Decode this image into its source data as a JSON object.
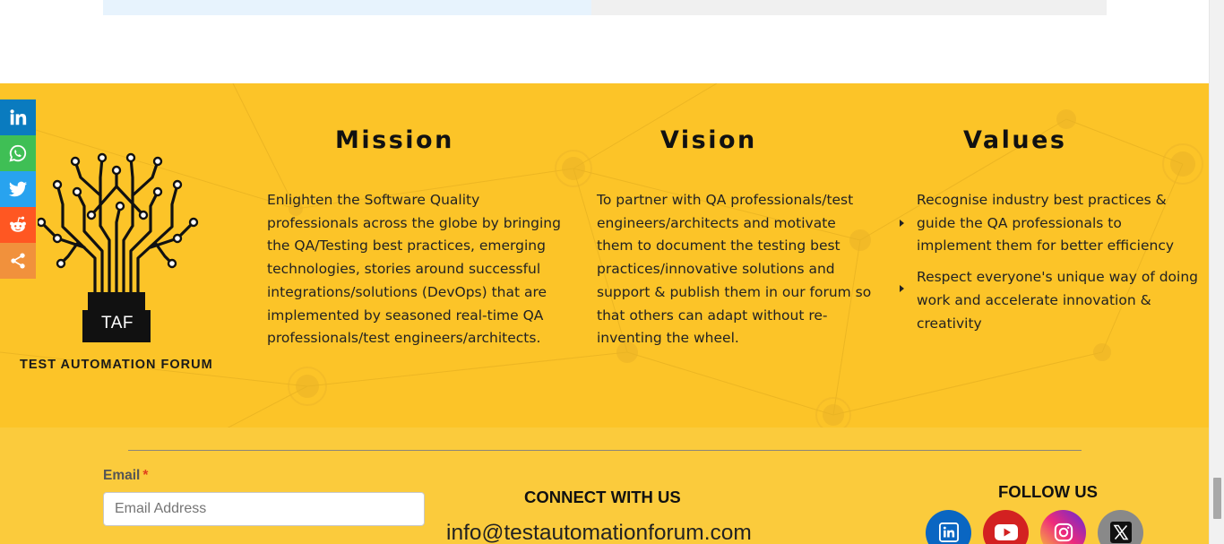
{
  "share_bar": {
    "buttons": [
      {
        "icon": "linkedin-icon",
        "color": "#0a7bbf"
      },
      {
        "icon": "whatsapp-icon",
        "color": "#3fbf55"
      },
      {
        "icon": "twitter-icon",
        "color": "#28a3ef"
      },
      {
        "icon": "reddit-icon",
        "color": "#ff5722"
      },
      {
        "icon": "share-icon",
        "color": "#f1913c"
      }
    ]
  },
  "logo": {
    "badge_text": "TAF",
    "caption": "TEST AUTOMATION FORUM"
  },
  "mission": {
    "title": "Mission",
    "text": "Enlighten the Software Quality professionals across the globe by bringing the QA/Testing best practices, emerging technologies, stories around successful integrations/solutions (DevOps) that are implemented by seasoned real-time QA professionals/test engineers/architects."
  },
  "vision": {
    "title": "Vision",
    "text": "To partner with QA professionals/test engineers/architects and motivate them to document the testing best practices/innovative solutions and support & publish them in our forum so that others can adapt without re-inventing the wheel."
  },
  "values": {
    "title": "Values",
    "items": [
      "Recognise industry best practices & guide the QA professionals to implement them for better efficiency",
      "Respect everyone's unique way of doing work and accelerate innovation & creativity"
    ]
  },
  "subscribe": {
    "label": "Email",
    "required_mark": "*",
    "placeholder": "Email Address",
    "value": ""
  },
  "connect": {
    "title": "CONNECT WITH US",
    "email": "info@testautomationforum.com"
  },
  "follow": {
    "title": "FOLLOW US",
    "links": [
      {
        "icon": "linkedin-icon",
        "color": "#0a66c2"
      },
      {
        "icon": "youtube-icon",
        "color": "#d32121"
      },
      {
        "icon": "instagram-icon",
        "color": "#c13584"
      },
      {
        "icon": "x-icon",
        "color": "#898989"
      }
    ]
  },
  "colors": {
    "footer_background": "#fcc428",
    "text": "#222222"
  }
}
